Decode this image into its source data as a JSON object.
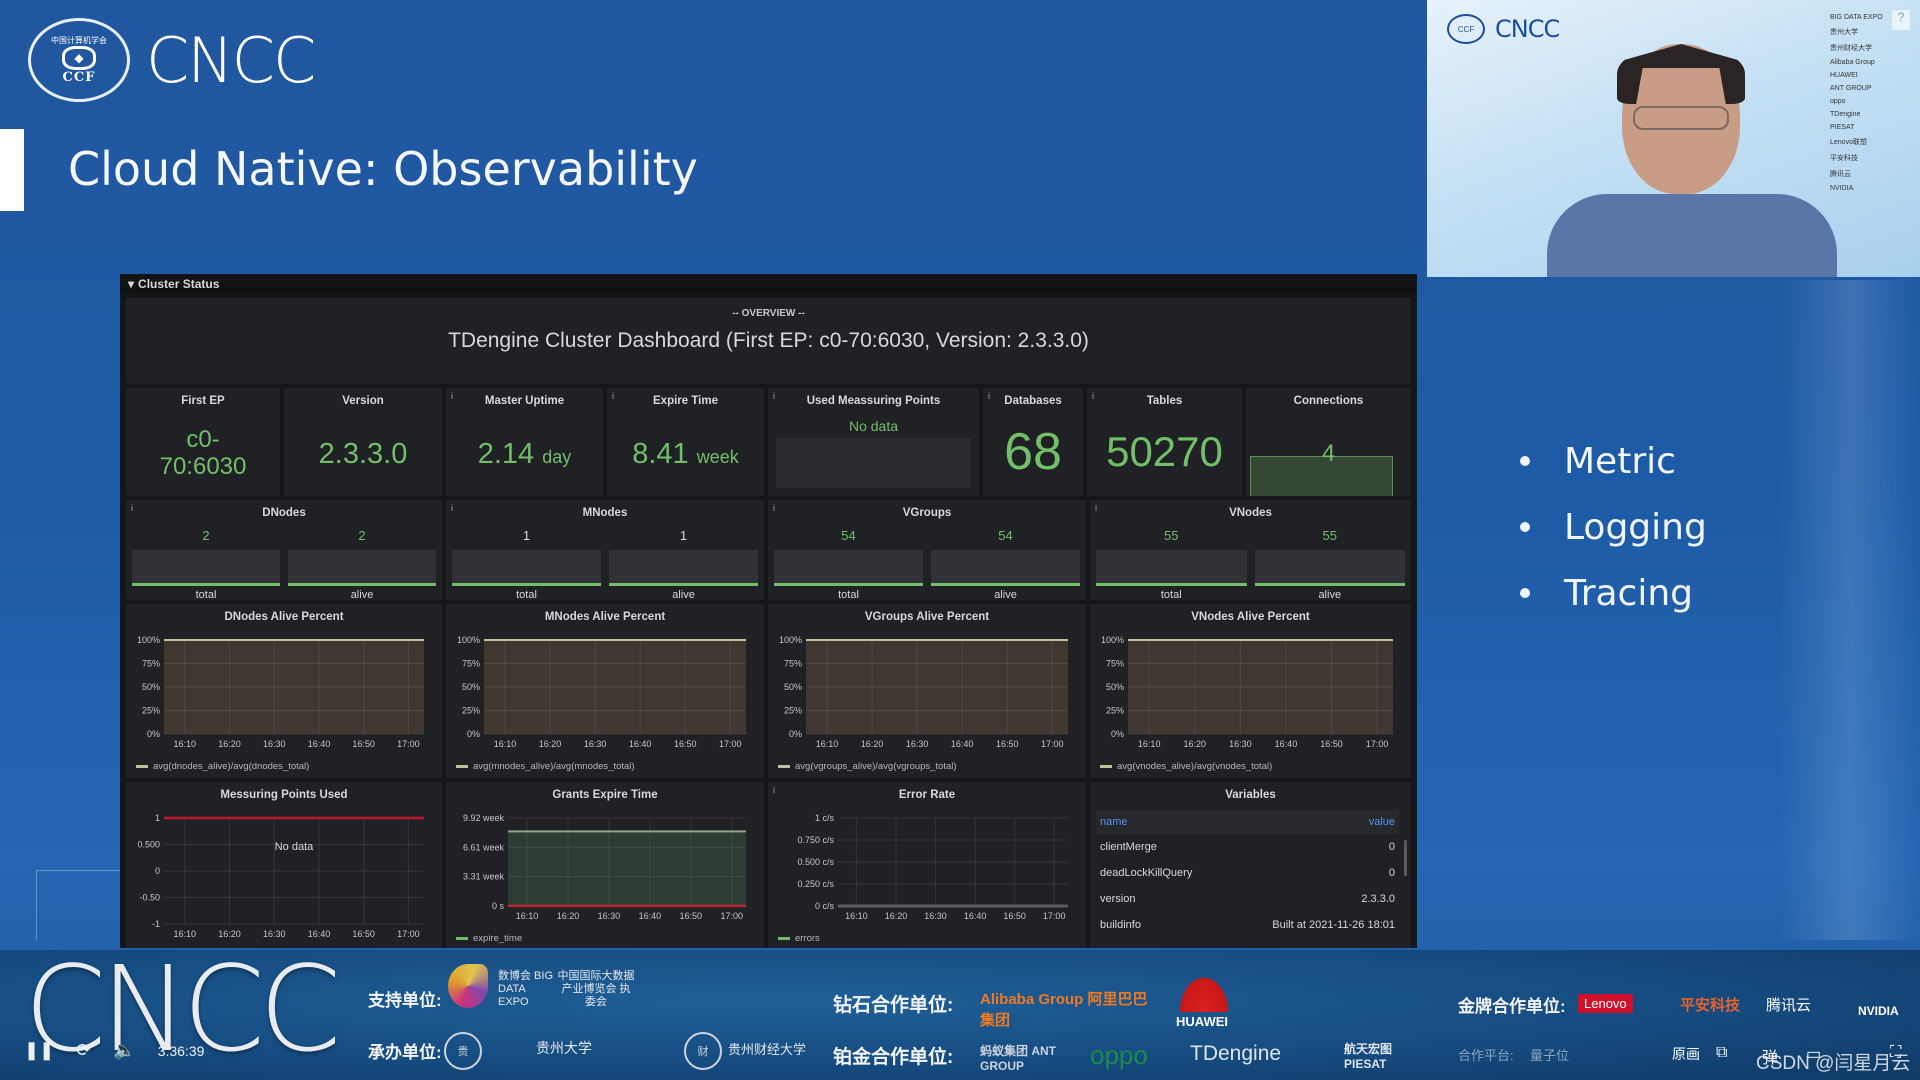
{
  "slide": {
    "logo_org": "CCF",
    "logo_org_cn": "中国计算机学会",
    "logo_word": "CNCC",
    "title": "Cloud Native: Observability",
    "bullets": [
      "Metric",
      "Logging",
      "Tracing"
    ]
  },
  "dashboard": {
    "row_title": "Cluster Status",
    "overview_label": "-- OVERVIEW --",
    "overview_title": "TDengine Cluster Dashboard (First EP: c0-70:6030, Version: 2.3.3.0)",
    "stats": [
      {
        "title": "First EP",
        "value_line1": "c0-",
        "value_line2": "70:6030"
      },
      {
        "title": "Version",
        "value": "2.3.3.0"
      },
      {
        "title": "Master Uptime",
        "value": "2.14",
        "unit": "day"
      },
      {
        "title": "Expire Time",
        "value": "8.41",
        "unit": "week"
      },
      {
        "title": "Used Meassuring Points",
        "value": "No data"
      },
      {
        "title": "Databases",
        "value": "68"
      },
      {
        "title": "Tables",
        "value": "50270"
      },
      {
        "title": "Connections",
        "value": "4"
      }
    ],
    "bar_panels": [
      {
        "title": "DNodes",
        "bars": [
          {
            "label": "total",
            "value": "2"
          },
          {
            "label": "alive",
            "value": "2"
          }
        ]
      },
      {
        "title": "MNodes",
        "bars": [
          {
            "label": "total",
            "value": "1"
          },
          {
            "label": "alive",
            "value": "1"
          }
        ]
      },
      {
        "title": "VGroups",
        "bars": [
          {
            "label": "total",
            "value": "54"
          },
          {
            "label": "alive",
            "value": "54"
          }
        ]
      },
      {
        "title": "VNodes",
        "bars": [
          {
            "label": "total",
            "value": "55"
          },
          {
            "label": "alive",
            "value": "55"
          }
        ]
      }
    ],
    "variables": {
      "title": "Variables",
      "columns": [
        "name",
        "value"
      ],
      "rows": [
        [
          "clientMerge",
          "0"
        ],
        [
          "deadLockKillQuery",
          "0"
        ],
        [
          "version",
          "2.3.3.0"
        ],
        [
          "buildinfo",
          "Built at 2021-11-26 18:01"
        ]
      ]
    },
    "colors": {
      "panel_bg": "#1f2125",
      "value_green": "#73bf69",
      "series_olive": "#b9c49a",
      "threshold_red": "#c4162a",
      "header_blue": "#5794f2"
    }
  },
  "chart_data": [
    {
      "type": "area",
      "title": "DNodes Alive Percent",
      "x": [
        "16:10",
        "16:20",
        "16:30",
        "16:40",
        "16:50",
        "17:00"
      ],
      "yticks": [
        "0%",
        "25%",
        "50%",
        "75%",
        "100%"
      ],
      "ylim": [
        0,
        100
      ],
      "series": [
        {
          "name": "avg(dnodes_alive)/avg(dnodes_total)",
          "values": [
            100,
            100,
            100,
            100,
            100,
            100
          ]
        }
      ],
      "legend": "bottom-left"
    },
    {
      "type": "area",
      "title": "MNodes Alive Percent",
      "x": [
        "16:10",
        "16:20",
        "16:30",
        "16:40",
        "16:50",
        "17:00"
      ],
      "yticks": [
        "0%",
        "25%",
        "50%",
        "75%",
        "100%"
      ],
      "ylim": [
        0,
        100
      ],
      "series": [
        {
          "name": "avg(mnodes_alive)/avg(mnodes_total)",
          "values": [
            100,
            100,
            100,
            100,
            100,
            100
          ]
        }
      ],
      "legend": "bottom-left"
    },
    {
      "type": "area",
      "title": "VGroups Alive Percent",
      "x": [
        "16:10",
        "16:20",
        "16:30",
        "16:40",
        "16:50",
        "17:00"
      ],
      "yticks": [
        "0%",
        "25%",
        "50%",
        "75%",
        "100%"
      ],
      "ylim": [
        0,
        100
      ],
      "series": [
        {
          "name": "avg(vgroups_alive)/avg(vgroups_total)",
          "values": [
            100,
            100,
            100,
            100,
            100,
            100
          ]
        }
      ],
      "legend": "bottom-left"
    },
    {
      "type": "area",
      "title": "VNodes Alive Percent",
      "x": [
        "16:10",
        "16:20",
        "16:30",
        "16:40",
        "16:50",
        "17:00"
      ],
      "yticks": [
        "0%",
        "25%",
        "50%",
        "75%",
        "100%"
      ],
      "ylim": [
        0,
        100
      ],
      "series": [
        {
          "name": "avg(vnodes_alive)/avg(vnodes_total)",
          "values": [
            100,
            100,
            100,
            100,
            100,
            100
          ]
        }
      ],
      "legend": "bottom-left"
    },
    {
      "type": "line",
      "title": "Messuring Points Used",
      "x": [
        "16:10",
        "16:20",
        "16:30",
        "16:40",
        "16:50",
        "17:00"
      ],
      "yticks": [
        "-1",
        "-0.50",
        "0",
        "0.500",
        "1"
      ],
      "ylim": [
        -1,
        1
      ],
      "series": [],
      "threshold": 1,
      "annotation": "No data"
    },
    {
      "type": "area",
      "title": "Grants Expire Time",
      "x": [
        "16:10",
        "16:20",
        "16:30",
        "16:40",
        "16:50",
        "17:00"
      ],
      "yticks": [
        "0 s",
        "3.31 week",
        "6.61 week",
        "9.92 week"
      ],
      "ylim": [
        0,
        9.92
      ],
      "series": [
        {
          "name": "expire_time",
          "values": [
            8.41,
            8.41,
            8.41,
            8.41,
            8.41,
            8.41
          ]
        }
      ],
      "threshold": 0,
      "legend": "bottom-left"
    },
    {
      "type": "line",
      "title": "Error Rate",
      "x": [
        "16:10",
        "16:20",
        "16:30",
        "16:40",
        "16:50",
        "17:00"
      ],
      "yticks": [
        "0 c/s",
        "0.250 c/s",
        "0.500 c/s",
        "0.750 c/s",
        "1 c/s"
      ],
      "ylim": [
        0,
        1
      ],
      "series": [
        {
          "name": "errors",
          "values": [
            0,
            0,
            0,
            0,
            0,
            0
          ]
        }
      ],
      "legend": "bottom-left"
    }
  ],
  "video": {
    "logo_word": "CNCC",
    "sponsors": [
      "BIG DATA EXPO",
      "贵州大学",
      "贵州财经大学",
      "Alibaba Group",
      "HUAWEI",
      "ANT GROUP",
      "oppo",
      "TDengine",
      "PIESAT",
      "Lenovo联想",
      "平安科技",
      "腾讯云",
      "NVIDIA"
    ]
  },
  "banner": {
    "logo_word": "CNCC",
    "time": "3:36:39",
    "support_label": "支持单位:",
    "support_logo": "数博会 BIG DATA EXPO",
    "support_org": "中国国际大数据 产业博览会 执委会",
    "host_label": "承办单位:",
    "host_orgs": [
      "贵州大学",
      "贵州财经大学"
    ],
    "diamond_label": "钻石合作单位:",
    "diamond_sponsors": [
      "Alibaba Group 阿里巴巴集团",
      "HUAWEI"
    ],
    "platinum_label": "铂金合作单位:",
    "platinum_sponsors": [
      "蚂蚁集团 ANT GROUP",
      "oppo",
      "TDengine",
      "航天宏图 PIESAT"
    ],
    "gold_label": "金牌合作单位:",
    "gold_sponsors": [
      "Lenovo",
      "平安科技",
      "腾讯云",
      "NVIDIA"
    ],
    "platform_label": "合作平台:",
    "platform_items": [
      "量子位"
    ],
    "watermark": "CSDN @闫星月云",
    "player_labels": {
      "quality": "原画"
    }
  }
}
